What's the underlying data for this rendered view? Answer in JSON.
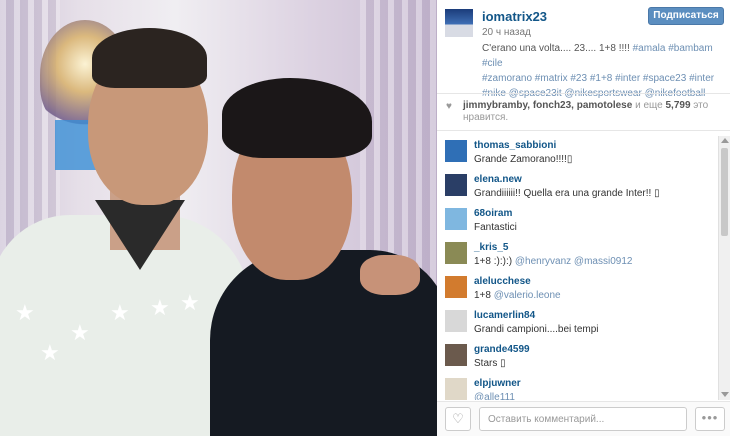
{
  "post": {
    "username": "iomatrix23",
    "time": "20 ч назад",
    "follow_label": "Подписаться",
    "caption_text": "C'erano una volta.... 23.... 1+8 !!!!",
    "caption_tags_1": "#amala #bambam #cile",
    "caption_line2": "#zamorano #matrix #23 #1+8 #inter #space23 #inter",
    "caption_line3": "#nike @space23it @nikesportswear @nikefootball"
  },
  "likes": {
    "users": "jimmybramby, fonch23, pamotolese",
    "middle": " и еще ",
    "count": "5,799",
    "suffix": " это нравится."
  },
  "comments": [
    {
      "name": "thomas_sabbioni",
      "text": "Grande Zamorano!!!!",
      "mention": "",
      "emoji": "▯",
      "avatar_color": "#2f6fb6"
    },
    {
      "name": "elena.new",
      "text": "Grandiiiiii!! Quella era una grande Inter!! ",
      "mention": "",
      "emoji": "▯",
      "avatar_color": "#2a3e66"
    },
    {
      "name": "68oiram",
      "text": "Fantastici",
      "mention": "",
      "emoji": "",
      "avatar_color": "#7fb7e0"
    },
    {
      "name": "_kris_5",
      "text": "1+8 :):):) ",
      "mention": "@henryvanz @massi0912",
      "emoji": "",
      "avatar_color": "#8a8a55"
    },
    {
      "name": "alelucchese",
      "text": "1+8 ",
      "mention": "@valerio.leone",
      "emoji": "",
      "avatar_color": "#d27b2e"
    },
    {
      "name": "lucamerlin84",
      "text": "Grandi campioni....bei tempi",
      "mention": "",
      "emoji": "",
      "avatar_color": "#d8d8d8"
    },
    {
      "name": "grande4599",
      "text": "Stars ",
      "mention": "",
      "emoji": "▯",
      "avatar_color": "#6b5a4d"
    },
    {
      "name": "elpjuwner",
      "text": "",
      "mention": "@alle111",
      "emoji": "",
      "avatar_color": "#e0d8c8"
    }
  ],
  "footer": {
    "comment_placeholder": "Оставить комментарий...",
    "heart_icon": "♡",
    "more_icon": "•••"
  },
  "colors": {
    "link": "#125688",
    "tag": "#6d8fb3",
    "follow_button": "#5b8ec0"
  }
}
